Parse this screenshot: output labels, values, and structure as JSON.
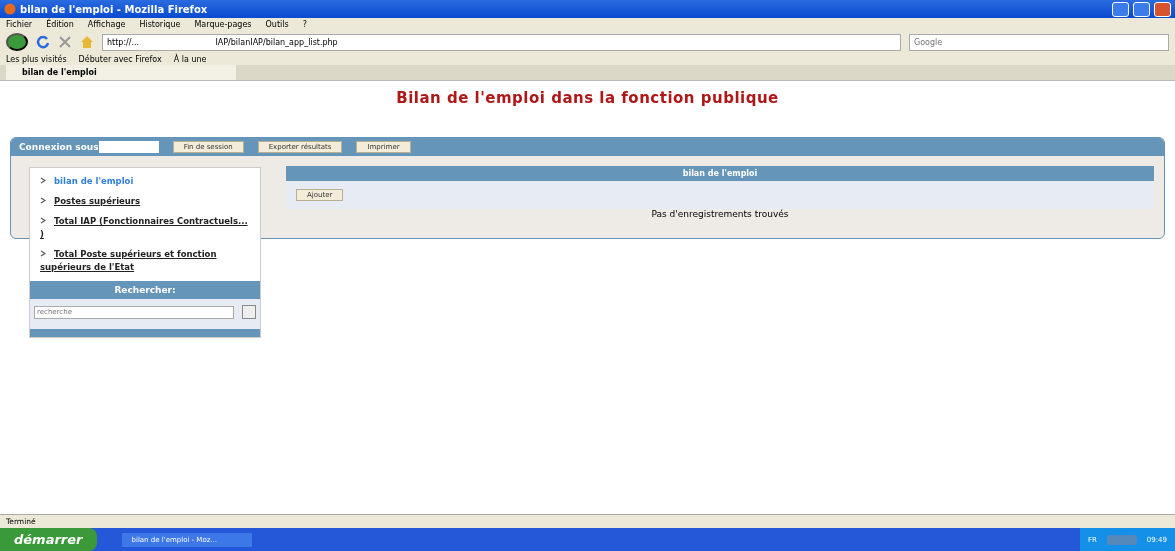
{
  "window": {
    "title": "bilan de l'emploi - Mozilla Firefox"
  },
  "menu": [
    "Fichier",
    "Édition",
    "Affichage",
    "Historique",
    "Marque-pages",
    "Outils",
    "?"
  ],
  "address": {
    "value": "http://...                              IAP/bilanIAP/bilan_app_list.php"
  },
  "search": {
    "placeholder": "Google"
  },
  "bookmarks": [
    "Les plus visités",
    "Débuter avec Firefox",
    "À la une"
  ],
  "tabs": [
    {
      "label": "bilan de l'emploi",
      "selected": true
    }
  ],
  "page": {
    "title": "Bilan de l'emploi dans la fonction publique",
    "session_label": "Connexion sous",
    "buttons": [
      "Fin de session",
      "Exporter résultats",
      "Imprimer"
    ],
    "sidebar": {
      "items": [
        {
          "label": "bilan de l'emploi",
          "selected": true
        },
        {
          "label": "Postes supérieurs",
          "selected": false
        },
        {
          "label": "Total IAP (Fonctionnaires Contractuels... )",
          "selected": false
        },
        {
          "label": "Total Poste supérieurs et fonction supérieurs de l'Etat",
          "selected": false
        }
      ],
      "search_title": "Rechercher:",
      "search_placeholder": "recherche"
    },
    "table": {
      "title": "bilan de l'emploi",
      "add_button": "Ajouter",
      "empty": "Pas d'enregistrements trouvés"
    }
  },
  "status_bar": "Terminé",
  "taskbar": {
    "start": "démarrer",
    "tasks": [
      "bilan de l'emploi - Moz..."
    ],
    "lang": "FR",
    "time": "09:49"
  }
}
